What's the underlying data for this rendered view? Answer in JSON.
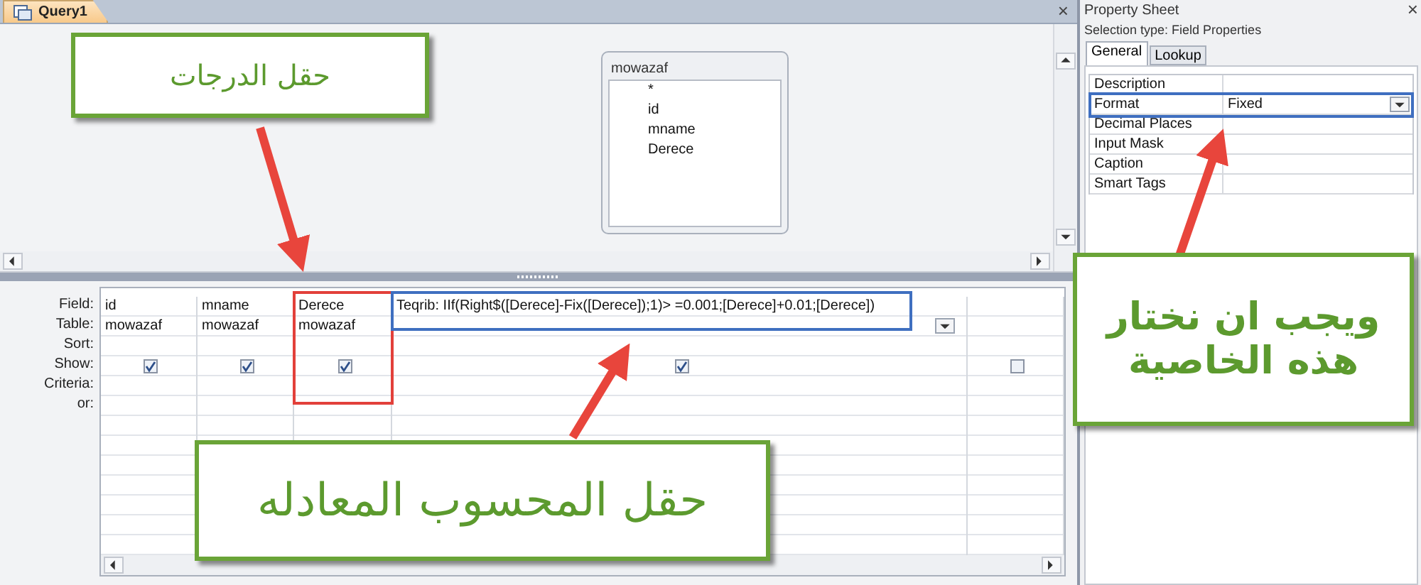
{
  "document_tab": {
    "label": "Query1",
    "selected": true
  },
  "close_glyph": "×",
  "table_box": {
    "title": "mowazaf",
    "fields": [
      "*",
      "id",
      "mname",
      "Derece"
    ]
  },
  "grid": {
    "row_labels": [
      "Field:",
      "Table:",
      "Sort:",
      "Show:",
      "Criteria:",
      "or:"
    ],
    "columns": [
      {
        "field": "id",
        "table": "mowazaf",
        "show": true,
        "dropdown": false
      },
      {
        "field": "mname",
        "table": "mowazaf",
        "show": true,
        "dropdown": false
      },
      {
        "field": "Derece",
        "table": "mowazaf",
        "show": true,
        "dropdown": false,
        "color": "#e2403a"
      },
      {
        "field": "Teqrib: IIf(Right$([Derece]-Fix([Derece]);1)> =0.001;[Derece]+0.01;[Derece])",
        "show": true,
        "dropdown": true,
        "color": "#3f6fc0"
      },
      {
        "show": false,
        "dropdown": false
      }
    ]
  },
  "property_sheet": {
    "title": "Property Sheet",
    "close_glyph": "×",
    "selection": "Selection type:  Field Properties",
    "tabs": [
      {
        "label": "General",
        "selected": true
      },
      {
        "label": "Lookup",
        "selected": false
      }
    ],
    "properties": [
      {
        "label": "Description",
        "dropdown": false
      },
      {
        "label": "Format",
        "value": "Fixed",
        "dropdown": true,
        "color": "#3f6fc0"
      },
      {
        "label": "Decimal Places",
        "dropdown": false
      },
      {
        "label": "Input Mask",
        "dropdown": false
      },
      {
        "label": "Caption",
        "dropdown": false
      },
      {
        "label": "Smart Tags",
        "dropdown": false
      }
    ]
  },
  "callouts": [
    {
      "lines": [
        "حقل الدرجات"
      ]
    },
    {
      "lines": [
        "حقل المحسوب المعادله"
      ]
    },
    {
      "lines": [
        "ويجب ان نختار",
        "هذه الخاصية"
      ]
    }
  ]
}
